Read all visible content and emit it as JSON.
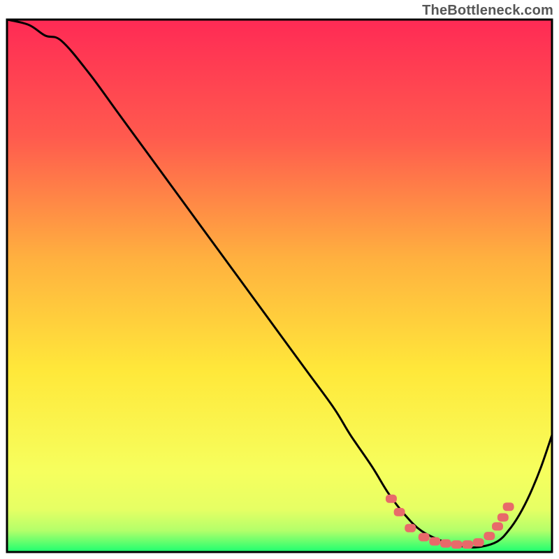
{
  "attribution": "TheBottleneck.com",
  "chart_data": {
    "type": "line",
    "title": "",
    "xlabel": "",
    "ylabel": "",
    "xlim": [
      0,
      100
    ],
    "ylim": [
      0,
      100
    ],
    "background_gradient": {
      "top": "#ff2a55",
      "upper": "#ff7a4a",
      "mid": "#ffd23d",
      "lower": "#f8ff60",
      "band": "#d6ff6a",
      "bottom": "#21ff70"
    },
    "series": [
      {
        "name": "bottleneck-curve",
        "x": [
          0,
          4,
          7,
          10,
          15,
          20,
          25,
          30,
          35,
          40,
          45,
          50,
          55,
          60,
          63,
          67,
          70,
          73,
          76,
          80,
          84,
          87,
          90,
          92,
          94,
          96,
          98,
          100
        ],
        "y": [
          100,
          99,
          97,
          96,
          90,
          83,
          76,
          69,
          62,
          55,
          48,
          41,
          34,
          27,
          22,
          16,
          11,
          7,
          4,
          2,
          1,
          1,
          2,
          4,
          7,
          11,
          16,
          22
        ]
      }
    ],
    "markers": {
      "name": "optimal-range-markers",
      "color": "#e86a6a",
      "points": [
        {
          "x": 70.5,
          "y": 10.0
        },
        {
          "x": 72.0,
          "y": 7.5
        },
        {
          "x": 74.0,
          "y": 4.5
        },
        {
          "x": 76.5,
          "y": 2.8
        },
        {
          "x": 78.5,
          "y": 2.0
        },
        {
          "x": 80.5,
          "y": 1.6
        },
        {
          "x": 82.5,
          "y": 1.4
        },
        {
          "x": 84.5,
          "y": 1.4
        },
        {
          "x": 86.5,
          "y": 1.8
        },
        {
          "x": 88.5,
          "y": 3.0
        },
        {
          "x": 90.0,
          "y": 4.8
        },
        {
          "x": 91.0,
          "y": 6.5
        },
        {
          "x": 92.0,
          "y": 8.5
        }
      ]
    }
  }
}
